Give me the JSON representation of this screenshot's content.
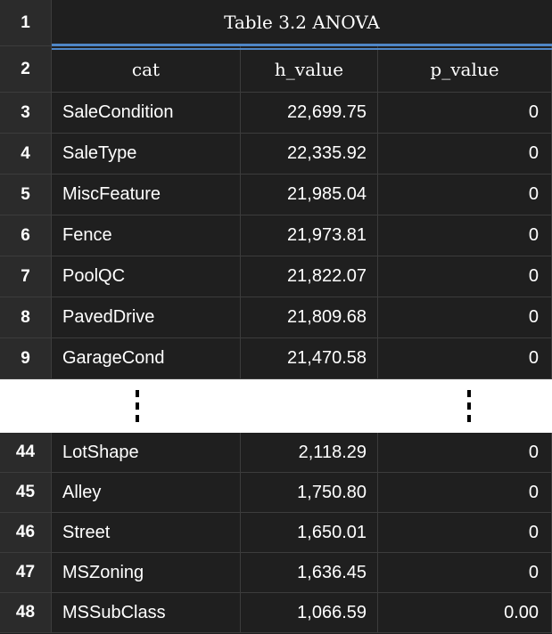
{
  "table": {
    "title": "Table 3.2 ANOVA",
    "title_row_num": "1",
    "header_row_num": "2",
    "headers": {
      "cat": "cat",
      "h_value": "h_value",
      "p_value": "p_value"
    },
    "top_rows": [
      {
        "num": "3",
        "cat": "SaleCondition",
        "h_value": "22,699.75",
        "p_value": "0"
      },
      {
        "num": "4",
        "cat": "SaleType",
        "h_value": "22,335.92",
        "p_value": "0"
      },
      {
        "num": "5",
        "cat": "MiscFeature",
        "h_value": "21,985.04",
        "p_value": "0"
      },
      {
        "num": "6",
        "cat": "Fence",
        "h_value": "21,973.81",
        "p_value": "0"
      },
      {
        "num": "7",
        "cat": "PoolQC",
        "h_value": "21,822.07",
        "p_value": "0"
      },
      {
        "num": "8",
        "cat": "PavedDrive",
        "h_value": "21,809.68",
        "p_value": "0"
      },
      {
        "num": "9",
        "cat": "GarageCond",
        "h_value": "21,470.58",
        "p_value": "0"
      }
    ],
    "bottom_rows": [
      {
        "num": "44",
        "cat": "LotShape",
        "h_value": "2,118.29",
        "p_value": "0"
      },
      {
        "num": "45",
        "cat": "Alley",
        "h_value": "1,750.80",
        "p_value": "0"
      },
      {
        "num": "46",
        "cat": "Street",
        "h_value": "1,650.01",
        "p_value": "0"
      },
      {
        "num": "47",
        "cat": "MSZoning",
        "h_value": "1,636.45",
        "p_value": "0"
      },
      {
        "num": "48",
        "cat": "MSSubClass",
        "h_value": "1,066.59",
        "p_value": "0.00"
      }
    ]
  },
  "colors": {
    "background": "#1f1f1f",
    "row_number_background": "#2b2b2b",
    "accent_underline": "#4f86c6",
    "text": "#ffffff"
  }
}
